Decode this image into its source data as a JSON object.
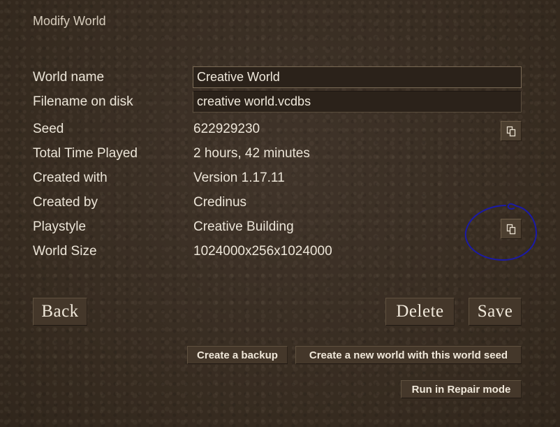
{
  "dialog": {
    "title": "Modify World"
  },
  "fields": {
    "world_name": {
      "label": "World name",
      "value": "Creative World"
    },
    "filename": {
      "label": "Filename on disk",
      "value": "creative world.vcdbs"
    },
    "seed": {
      "label": "Seed",
      "value": "622929230"
    },
    "time_played": {
      "label": "Total Time Played",
      "value": "2 hours, 42 minutes"
    },
    "created_with": {
      "label": "Created with",
      "value": "Version 1.17.11"
    },
    "created_by": {
      "label": "Created by",
      "value": "Credinus"
    },
    "playstyle": {
      "label": "Playstyle",
      "value": "Creative Building"
    },
    "world_size": {
      "label": "World Size",
      "value": "1024000x256x1024000"
    }
  },
  "buttons": {
    "back": "Back",
    "delete": "Delete",
    "save": "Save",
    "backup": "Create a backup",
    "new_world_seed": "Create a new world with this world seed",
    "repair": "Run in Repair mode"
  },
  "icons": {
    "copy_seed": "copy-icon",
    "copy_playstyle": "copy-icon"
  },
  "colors": {
    "annotation": "#1a1aa8"
  }
}
